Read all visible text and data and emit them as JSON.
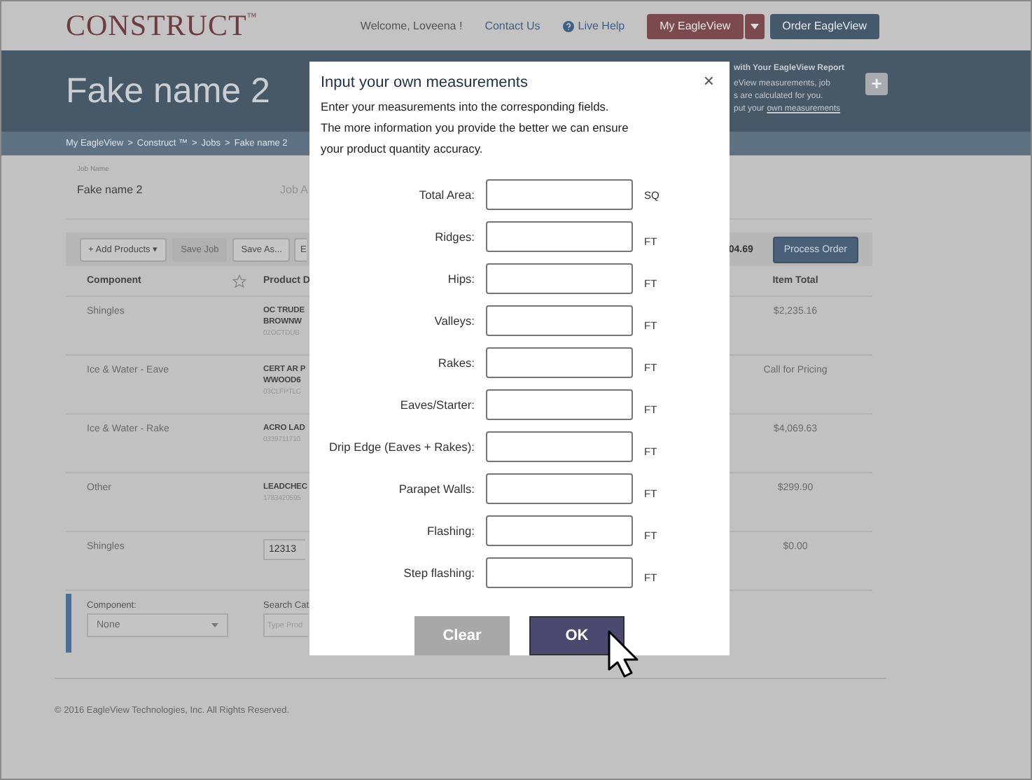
{
  "top_bar": {
    "logo": "CONSTRUCT",
    "logo_mark": "™",
    "welcome": "Welcome, Loveena !",
    "links": [
      {
        "label": "Contact Us",
        "kind": "plain"
      },
      {
        "label": "Live Help",
        "kind": "help"
      }
    ],
    "buttons": [
      {
        "label": "My EagleView",
        "kind": "dropdown"
      },
      {
        "label": "Order EagleView",
        "kind": "plain"
      }
    ]
  },
  "header": {
    "title": "Fake name 2",
    "promo_title": "with Your EagleView Report",
    "promo_lines": [
      "eView measurements, job",
      "s are calculated for you."
    ],
    "promo_prefix": "put your",
    "promo_link": "own measurements",
    "add_button": "+"
  },
  "breadcrumb": {
    "separator": ">",
    "items": [
      "My EagleView",
      "Construct ™",
      "Jobs",
      "Fake name 2"
    ]
  },
  "job": {
    "name_label": "Job Name",
    "name": "Fake name 2",
    "column_2": "Job A"
  },
  "toolbar": {
    "buttons": [
      {
        "label": "+ Add Products ▾",
        "disabled": false
      },
      {
        "label": "Save Job",
        "disabled": true
      },
      {
        "label": "Save As...",
        "disabled": false
      },
      {
        "label": "E",
        "disabled": false
      }
    ],
    "total": "04.69",
    "process_button": "Process Order"
  },
  "table": {
    "columns": [
      "Component",
      "Product D",
      "Item Total"
    ],
    "rows": [
      {
        "kind": "product",
        "component": "Shingles",
        "product": [
          "OC TRUDE",
          "BROWNW"
        ],
        "code": "02OCTDUB",
        "total": "$2,235.16"
      },
      {
        "kind": "product",
        "component": "Ice & Water - Eave",
        "product": [
          "CERT AR P",
          "WWOOD6"
        ],
        "code": "03CLFPTLC",
        "total": "Call for Pricing"
      },
      {
        "kind": "product",
        "component": "Ice & Water - Rake",
        "product": [
          "ACRO LAD"
        ],
        "code": "0339711710",
        "total": "$4,069.63"
      },
      {
        "kind": "product",
        "component": "Other",
        "product": [
          "LEADCHEC"
        ],
        "code": "1783420595",
        "total": "$299.90"
      },
      {
        "kind": "input",
        "component": "Shingles",
        "value": "12313",
        "total": "$0.00"
      }
    ]
  },
  "add_row": {
    "component_label": "Component:",
    "component_value": "None",
    "search_label": "Search Cat",
    "search_placeholder": "Type Prod"
  },
  "footer": "© 2016 EagleView Technologies, Inc. All Rights Reserved.",
  "dialog": {
    "title": "Input your own measurements",
    "close": "×",
    "description": [
      "Enter your measurements into the corresponding fields.",
      "The more information you provide the better we can ensure",
      "your product quantity accuracy."
    ],
    "fields": [
      {
        "label": "Total Area:",
        "unit": "SQ"
      },
      {
        "label": "Ridges:",
        "unit": "FT"
      },
      {
        "label": "Hips:",
        "unit": "FT"
      },
      {
        "label": "Valleys:",
        "unit": "FT"
      },
      {
        "label": "Rakes:",
        "unit": "FT"
      },
      {
        "label": "Eaves/Starter:",
        "unit": "FT"
      },
      {
        "label": "Drip Edge (Eaves + Rakes):",
        "unit": "FT"
      },
      {
        "label": "Parapet Walls:",
        "unit": "FT"
      },
      {
        "label": "Flashing:",
        "unit": "FT"
      },
      {
        "label": "Step flashing:",
        "unit": "FT"
      }
    ],
    "buttons": [
      {
        "label": "Clear",
        "disabled": true
      },
      {
        "label": "OK",
        "disabled": false
      }
    ]
  }
}
